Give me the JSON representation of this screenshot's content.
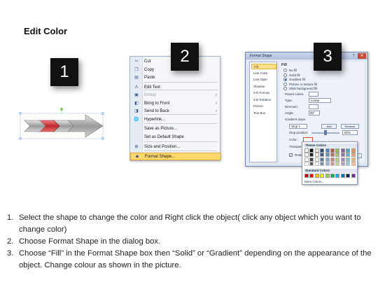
{
  "page": {
    "title": "Edit Color"
  },
  "badges": [
    "1",
    "2",
    "3"
  ],
  "context_menu": {
    "items": [
      {
        "label": "Cut",
        "icon": "scissors-icon",
        "glyph": "✂",
        "enabled": true
      },
      {
        "label": "Copy",
        "icon": "copy-icon",
        "glyph": "❐",
        "enabled": true
      },
      {
        "label": "Paste",
        "icon": "paste-icon",
        "glyph": "▤",
        "enabled": true
      },
      {
        "label": "Edit Text",
        "icon": "edit-text-icon",
        "glyph": "A",
        "enabled": true
      },
      {
        "label": "Group",
        "icon": "group-icon",
        "glyph": "▣",
        "enabled": false,
        "submenu": true
      },
      {
        "label": "Bring to Front",
        "icon": "bring-front-icon",
        "glyph": "◧",
        "enabled": true,
        "submenu": true
      },
      {
        "label": "Send to Back",
        "icon": "send-back-icon",
        "glyph": "◨",
        "enabled": true,
        "submenu": true
      },
      {
        "label": "Hyperlink...",
        "icon": "hyperlink-icon",
        "glyph": "🌐",
        "enabled": true
      },
      {
        "label": "Save as Picture...",
        "icon": "",
        "glyph": "",
        "enabled": true
      },
      {
        "label": "Set as Default Shape",
        "icon": "",
        "glyph": "",
        "enabled": true
      },
      {
        "label": "Size and Position...",
        "icon": "size-position-icon",
        "glyph": "⊞",
        "enabled": true
      },
      {
        "label": "Format Shape...",
        "icon": "format-shape-icon",
        "glyph": "◆",
        "enabled": true,
        "highlighted": true
      }
    ]
  },
  "format_dialog": {
    "title": "Format Shape",
    "help": "?",
    "close": "✕",
    "categories": [
      "Fill",
      "Line Color",
      "Line Style",
      "Shadow",
      "3-D Format",
      "3-D Rotation",
      "Picture",
      "Text Box"
    ],
    "selected_category": "Fill",
    "section_title": "Fill",
    "fill_options": [
      "No fill",
      "Solid fill",
      "Gradient fill",
      "Picture or texture fill",
      "Slide background fill"
    ],
    "selected_fill": "Gradient fill",
    "fields": {
      "preset_colors": "Preset colors:",
      "type": "Type:",
      "type_value": "Linear",
      "direction": "Direction:",
      "angle": "Angle:",
      "angle_value": "90°",
      "gradient_stops": "Gradient stops",
      "stop_value": "Stop 1",
      "add": "Add",
      "remove": "Remove",
      "stop_position": "Stop position:",
      "stop_position_value": "50%",
      "color": "Color:",
      "transparency": "Transparen",
      "rotate": "Rotate"
    },
    "close_button": "Close"
  },
  "palette": {
    "theme_colors_label": "Theme Colors",
    "standard_colors_label": "Standard Colors",
    "more_colors": "More Colors...",
    "theme_row": [
      "#ffffff",
      "#000000",
      "#eeece1",
      "#1f497d",
      "#4f81bd",
      "#c0504d",
      "#9bbb59",
      "#8064a2",
      "#4bacc6",
      "#f79646"
    ],
    "standard_row": [
      "#c00000",
      "#ff0000",
      "#ffc000",
      "#ffff00",
      "#92d050",
      "#00b050",
      "#00b0f0",
      "#0070c0",
      "#002060",
      "#7030a0"
    ]
  },
  "instructions": [
    {
      "num": "1.",
      "text": "Select the shape to change the color and Right click the object( click any object which you want to change color)"
    },
    {
      "num": "2.",
      "text": "Choose Format Shape in the dialog box."
    },
    {
      "num": "3.",
      "text": "Choose “Fill” in the Format Shape box then “Solid” or “Gradient” depending on the appearance of the object. Change colour as shown in the picture."
    }
  ]
}
